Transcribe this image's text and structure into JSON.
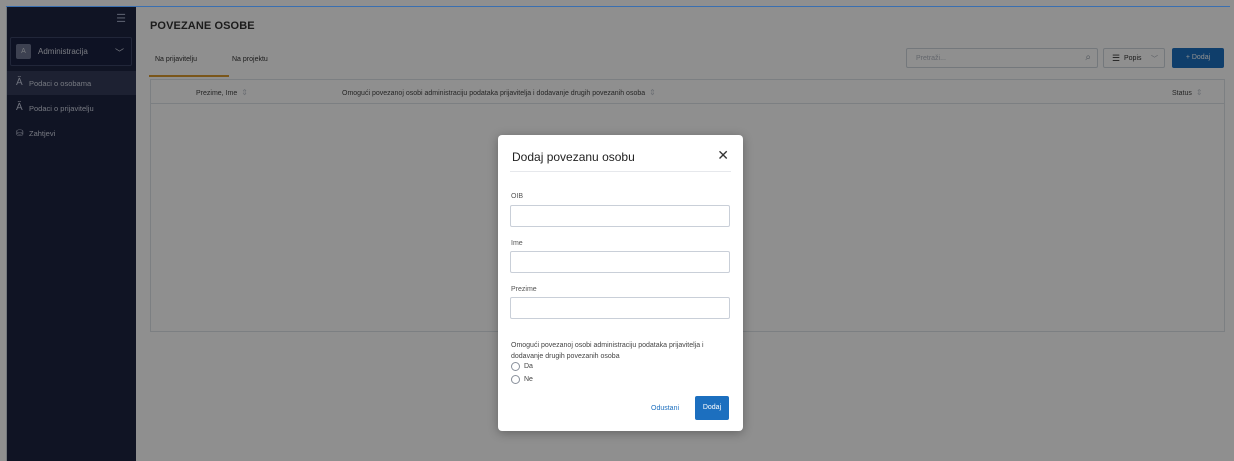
{
  "sidebar": {
    "menu_icon": "list-toggle-icon",
    "context": {
      "avatar": "A",
      "label": "Administracija",
      "chevron": "chevron-down-icon"
    },
    "items": [
      {
        "label": "Podaci o osobama",
        "icon": "person-icon",
        "active": true
      },
      {
        "label": "Podaci o prijavitelju",
        "icon": "person-icon",
        "active": false
      },
      {
        "label": "Zahtjevi",
        "icon": "stack-icon",
        "active": false
      }
    ]
  },
  "header": {
    "title": "POVEZANE OSOBE",
    "tabs": [
      {
        "label": "Na prijavitelju",
        "active": true
      },
      {
        "label": "Na projektu",
        "active": false
      }
    ]
  },
  "toolbar": {
    "search_placeholder": "Pretraži...",
    "view_label": "Popis",
    "add_label": "+ Dodaj"
  },
  "table": {
    "columns": [
      "Prezime, Ime",
      "Omogući povezanoj osobi administraciju podataka prijavitelja i dodavanje drugih povezanih osoba",
      "Status"
    ]
  },
  "modal": {
    "title": "Dodaj povezanu osobu",
    "fields": [
      {
        "label": "OIB",
        "value": ""
      },
      {
        "label": "Ime",
        "value": ""
      },
      {
        "label": "Prezime",
        "value": ""
      }
    ],
    "question": "Omogući povezanoj osobi administraciju podataka prijavitelja i dodavanje drugih povezanih osoba",
    "options": [
      "Da",
      "Ne"
    ],
    "cancel_label": "Odustani",
    "submit_label": "Dodaj"
  },
  "colors": {
    "sidebar_bg": "#1d2441",
    "accent": "#1c6fbf",
    "tab_underline": "#d99a2f"
  }
}
